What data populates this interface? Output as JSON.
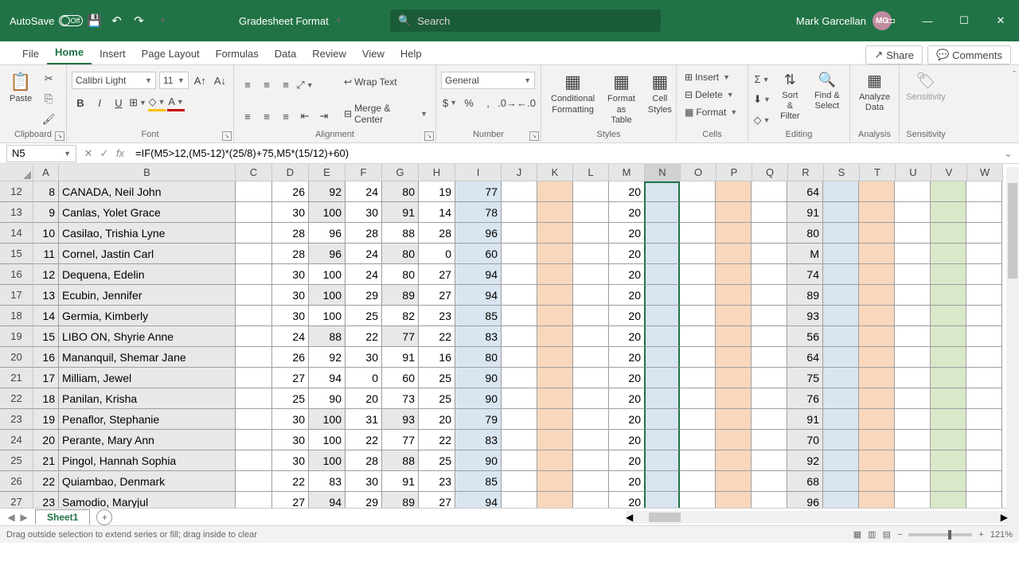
{
  "titlebar": {
    "autosave": "AutoSave",
    "off": "Off",
    "doc": "Gradesheet Format",
    "search": "Search",
    "user": "Mark Garcellan",
    "initials": "MG"
  },
  "tabs": [
    "File",
    "Home",
    "Insert",
    "Page Layout",
    "Formulas",
    "Data",
    "Review",
    "View",
    "Help"
  ],
  "share": "Share",
  "comments": "Comments",
  "ribbon": {
    "clipboard": "Clipboard",
    "paste": "Paste",
    "font": "Font",
    "fontname": "Calibri Light",
    "fontsize": "11",
    "align": "Alignment",
    "wrap": "Wrap Text",
    "merge": "Merge & Center",
    "number": "Number",
    "general": "General",
    "styles": "Styles",
    "cond": "Conditional Formatting",
    "fmtTable": "Format as Table",
    "cellStyles": "Cell Styles",
    "cells": "Cells",
    "insert": "Insert",
    "delete": "Delete",
    "format": "Format",
    "editing": "Editing",
    "sort": "Sort & Filter",
    "find": "Find & Select",
    "analyze": "Analyze Data",
    "analysis": "Analysis",
    "sens": "Sensitivity",
    "sensg": "Sensitivity"
  },
  "namebox": "N5",
  "formula": "=IF(M5>12,(M5-12)*(25/8)+75,M5*(15/12)+60)",
  "cols": [
    "A",
    "B",
    "C",
    "D",
    "E",
    "F",
    "G",
    "H",
    "I",
    "J",
    "K",
    "L",
    "M",
    "N",
    "O",
    "P",
    "Q",
    "R",
    "S",
    "T",
    "U",
    "V",
    "W"
  ],
  "colW": {
    "A": 32,
    "B": 222,
    "C": 46,
    "D": 46,
    "E": 46,
    "F": 46,
    "G": 46,
    "H": 46,
    "I": 58,
    "J": 45,
    "K": 45,
    "L": 45,
    "M": 45,
    "N": 45,
    "O": 45,
    "P": 45,
    "Q": 45,
    "R": 45,
    "S": 45,
    "T": 45,
    "U": 45,
    "V": 45,
    "W": 45
  },
  "rows": [
    {
      "n": 12,
      "A": 8,
      "B": "CANADA, Neil John",
      "D": 26,
      "E": 92,
      "F": 24,
      "G": 80,
      "H": 19,
      "I": 77,
      "M": 20,
      "R": 64
    },
    {
      "n": 13,
      "A": 9,
      "B": "Canlas, Yolet Grace",
      "D": 30,
      "E": 100,
      "F": 30,
      "G": 91,
      "H": 14,
      "I": 78,
      "M": 20,
      "R": 91
    },
    {
      "n": 14,
      "A": 10,
      "B": "Casilao, Trishia Lyne",
      "D": 28,
      "E": 96,
      "F": 28,
      "G": 88,
      "H": 28,
      "I": 96,
      "M": 20,
      "R": 80
    },
    {
      "n": 15,
      "A": 11,
      "B": "Cornel, Jastin Carl",
      "D": 28,
      "E": 96,
      "F": 24,
      "G": 80,
      "H": 0,
      "I": 60,
      "M": 20,
      "R": "M"
    },
    {
      "n": 16,
      "A": 12,
      "B": "Dequena, Edelin",
      "D": 30,
      "E": 100,
      "F": 24,
      "G": 80,
      "H": 27,
      "I": 94,
      "M": 20,
      "R": 74
    },
    {
      "n": 17,
      "A": 13,
      "B": "Ecubin, Jennifer",
      "D": 30,
      "E": 100,
      "F": 29,
      "G": 89,
      "H": 27,
      "I": 94,
      "M": 20,
      "R": 89
    },
    {
      "n": 18,
      "A": 14,
      "B": "Germia, Kimberly",
      "D": 30,
      "E": 100,
      "F": 25,
      "G": 82,
      "H": 23,
      "I": 85,
      "M": 20,
      "R": 93
    },
    {
      "n": 19,
      "A": 15,
      "B": "LIBO ON, Shyrie Anne",
      "D": 24,
      "E": 88,
      "F": 22,
      "G": 77,
      "H": 22,
      "I": 83,
      "M": 20,
      "R": 56
    },
    {
      "n": 20,
      "A": 16,
      "B": "Mananquil, Shemar Jane",
      "D": 26,
      "E": 92,
      "F": 30,
      "G": 91,
      "H": 16,
      "I": 80,
      "M": 20,
      "R": 64
    },
    {
      "n": 21,
      "A": 17,
      "B": "Milliam, Jewel",
      "D": 27,
      "E": 94,
      "F": 0,
      "G": 60,
      "H": 25,
      "I": 90,
      "M": 20,
      "R": 75
    },
    {
      "n": 22,
      "A": 18,
      "B": "Panilan, Krisha",
      "D": 25,
      "E": 90,
      "F": 20,
      "G": 73,
      "H": 25,
      "I": 90,
      "M": 20,
      "R": 76
    },
    {
      "n": 23,
      "A": 19,
      "B": "Penaflor, Stephanie",
      "D": 30,
      "E": 100,
      "F": 31,
      "G": 93,
      "H": 20,
      "I": 79,
      "M": 20,
      "R": 91
    },
    {
      "n": 24,
      "A": 20,
      "B": "Perante, Mary Ann",
      "D": 30,
      "E": 100,
      "F": 22,
      "G": 77,
      "H": 22,
      "I": 83,
      "M": 20,
      "R": 70
    },
    {
      "n": 25,
      "A": 21,
      "B": "Pingol, Hannah Sophia",
      "D": 30,
      "E": 100,
      "F": 28,
      "G": 88,
      "H": 25,
      "I": 90,
      "M": 20,
      "R": 92
    },
    {
      "n": 26,
      "A": 22,
      "B": "Quiambao, Denmark",
      "D": 22,
      "E": 83,
      "F": 30,
      "G": 91,
      "H": 23,
      "I": 85,
      "M": 20,
      "R": 68
    },
    {
      "n": 27,
      "A": 23,
      "B": "Samodio, Maryjul",
      "D": 27,
      "E": 94,
      "F": 29,
      "G": 89,
      "H": 27,
      "I": 94,
      "M": 20,
      "R": 96
    }
  ],
  "sheet": "Sheet1",
  "status": "Drag outside selection to extend series or fill; drag inside to clear",
  "zoom": "121%"
}
